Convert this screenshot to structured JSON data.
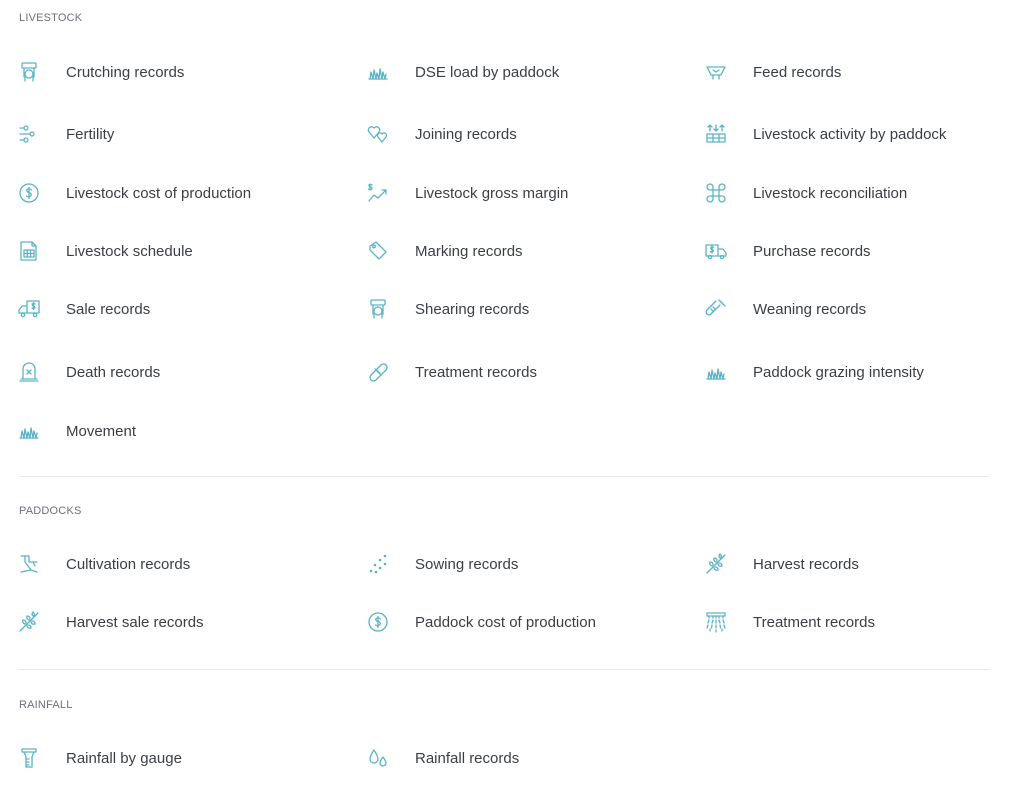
{
  "theme": {
    "icon_color": "#5ab3c6",
    "text_color": "#3a3f44",
    "heading_color": "#6b7178",
    "divider_color": "#e6e8ea"
  },
  "sections": {
    "livestock": {
      "title": "LIVESTOCK",
      "items": [
        {
          "label": "Crutching records",
          "icon": "sheep-icon"
        },
        {
          "label": "DSE load by paddock",
          "icon": "grass-icon"
        },
        {
          "label": "Feed records",
          "icon": "feed-trough-icon"
        },
        {
          "label": "Fertility",
          "icon": "fertility-icon"
        },
        {
          "label": "Joining records",
          "icon": "hearts-icon"
        },
        {
          "label": "Livestock activity by paddock",
          "icon": "paddock-activity-icon"
        },
        {
          "label": "Livestock cost of production",
          "icon": "dollar-circle-icon"
        },
        {
          "label": "Livestock gross margin",
          "icon": "trend-dollar-icon"
        },
        {
          "label": "Livestock reconciliation",
          "icon": "command-icon"
        },
        {
          "label": "Livestock schedule",
          "icon": "calendar-sheet-icon"
        },
        {
          "label": "Marking records",
          "icon": "tag-icon"
        },
        {
          "label": "Purchase records",
          "icon": "truck-dollar-icon"
        },
        {
          "label": "Sale records",
          "icon": "truck-sale-icon"
        },
        {
          "label": "Shearing records",
          "icon": "sheep-icon"
        },
        {
          "label": "Weaning records",
          "icon": "bottle-icon"
        },
        {
          "label": "Death records",
          "icon": "headstone-icon"
        },
        {
          "label": "Treatment records",
          "icon": "bandage-icon"
        },
        {
          "label": "Paddock grazing intensity",
          "icon": "grass-icon"
        },
        {
          "label": "Movement",
          "icon": "grass-icon"
        }
      ]
    },
    "paddocks": {
      "title": "PADDOCKS",
      "items": [
        {
          "label": "Cultivation records",
          "icon": "plough-icon"
        },
        {
          "label": "Sowing records",
          "icon": "seeds-icon"
        },
        {
          "label": "Harvest records",
          "icon": "wheat-icon"
        },
        {
          "label": "Harvest sale records",
          "icon": "wheat-icon"
        },
        {
          "label": "Paddock cost of production",
          "icon": "dollar-circle-icon"
        },
        {
          "label": "Treatment records",
          "icon": "sprayer-icon"
        }
      ]
    },
    "rainfall": {
      "title": "RAINFALL",
      "items": [
        {
          "label": "Rainfall by gauge",
          "icon": "rain-gauge-icon"
        },
        {
          "label": "Rainfall records",
          "icon": "water-drops-icon"
        }
      ]
    }
  }
}
